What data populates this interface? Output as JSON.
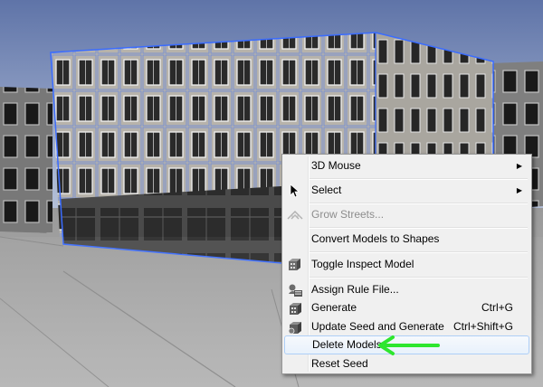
{
  "context_menu": {
    "items": [
      {
        "label": "3D Mouse",
        "submenu": true,
        "icon": "none"
      },
      {
        "label": "Select",
        "submenu": true,
        "icon": "cursor-icon"
      },
      {
        "label": "Grow Streets...",
        "disabled": true,
        "icon": "streets-icon"
      },
      {
        "label": "Convert Models to Shapes",
        "icon": "none"
      },
      {
        "label": "Toggle Inspect Model",
        "icon": "inspect-model-icon"
      },
      {
        "label": "Assign Rule File...",
        "icon": "rule-file-icon"
      },
      {
        "label": "Generate",
        "shortcut": "Ctrl+G",
        "icon": "generate-icon"
      },
      {
        "label": "Update Seed and Generate",
        "shortcut": "Ctrl+Shift+G",
        "icon": "update-seed-icon"
      },
      {
        "label": "Delete Models",
        "highlighted": true,
        "icon": "none"
      },
      {
        "label": "Reset Seed",
        "icon": "none"
      }
    ],
    "submenu_arrow": "▶"
  },
  "annotation": {
    "arrow_color": "#2ee62e",
    "points_to": "Delete Models"
  },
  "colors": {
    "selection_outline": "#3a6cff",
    "sky_top": "#6f82b3",
    "menu_bg": "#f0f0f0"
  }
}
